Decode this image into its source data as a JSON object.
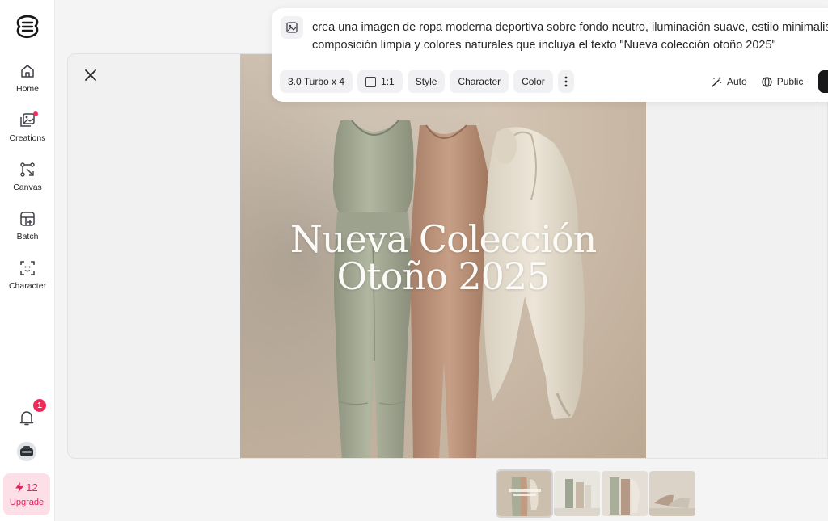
{
  "sidebar": {
    "items": [
      {
        "label": "Home",
        "icon": "home-icon"
      },
      {
        "label": "Creations",
        "icon": "images-icon",
        "has_dot": true
      },
      {
        "label": "Canvas",
        "icon": "canvas-icon"
      },
      {
        "label": "Batch",
        "icon": "batch-icon"
      },
      {
        "label": "Character",
        "icon": "face-scan-icon"
      }
    ],
    "notifications_count": "1",
    "credits": "12",
    "upgrade_label": "Upgrade"
  },
  "prompt": {
    "line1": "crea una imagen de ropa moderna deportiva sobre fondo neutro, iluminación suave, estilo minimalista,",
    "line2": "composición limpia y colores naturales que incluya el texto \"Nueva colección otoño 2025\""
  },
  "toolbar": {
    "model": "3.0 Turbo x 4",
    "ratio": "1:1",
    "style": "Style",
    "character": "Character",
    "color": "Color",
    "auto": "Auto",
    "visibility": "Public"
  },
  "image": {
    "title_line1": "Nueva Colección",
    "title_line2": "Otoño 2025"
  },
  "thumbnails": {
    "count": 4,
    "selected_index": 0
  },
  "colors": {
    "accent": "#ef2b5c",
    "upgrade_bg": "#fde0e7",
    "upgrade_text": "#e0245e",
    "sage": "#a8ad98",
    "terracotta": "#c29a82",
    "jacket": "#e6ded0"
  }
}
